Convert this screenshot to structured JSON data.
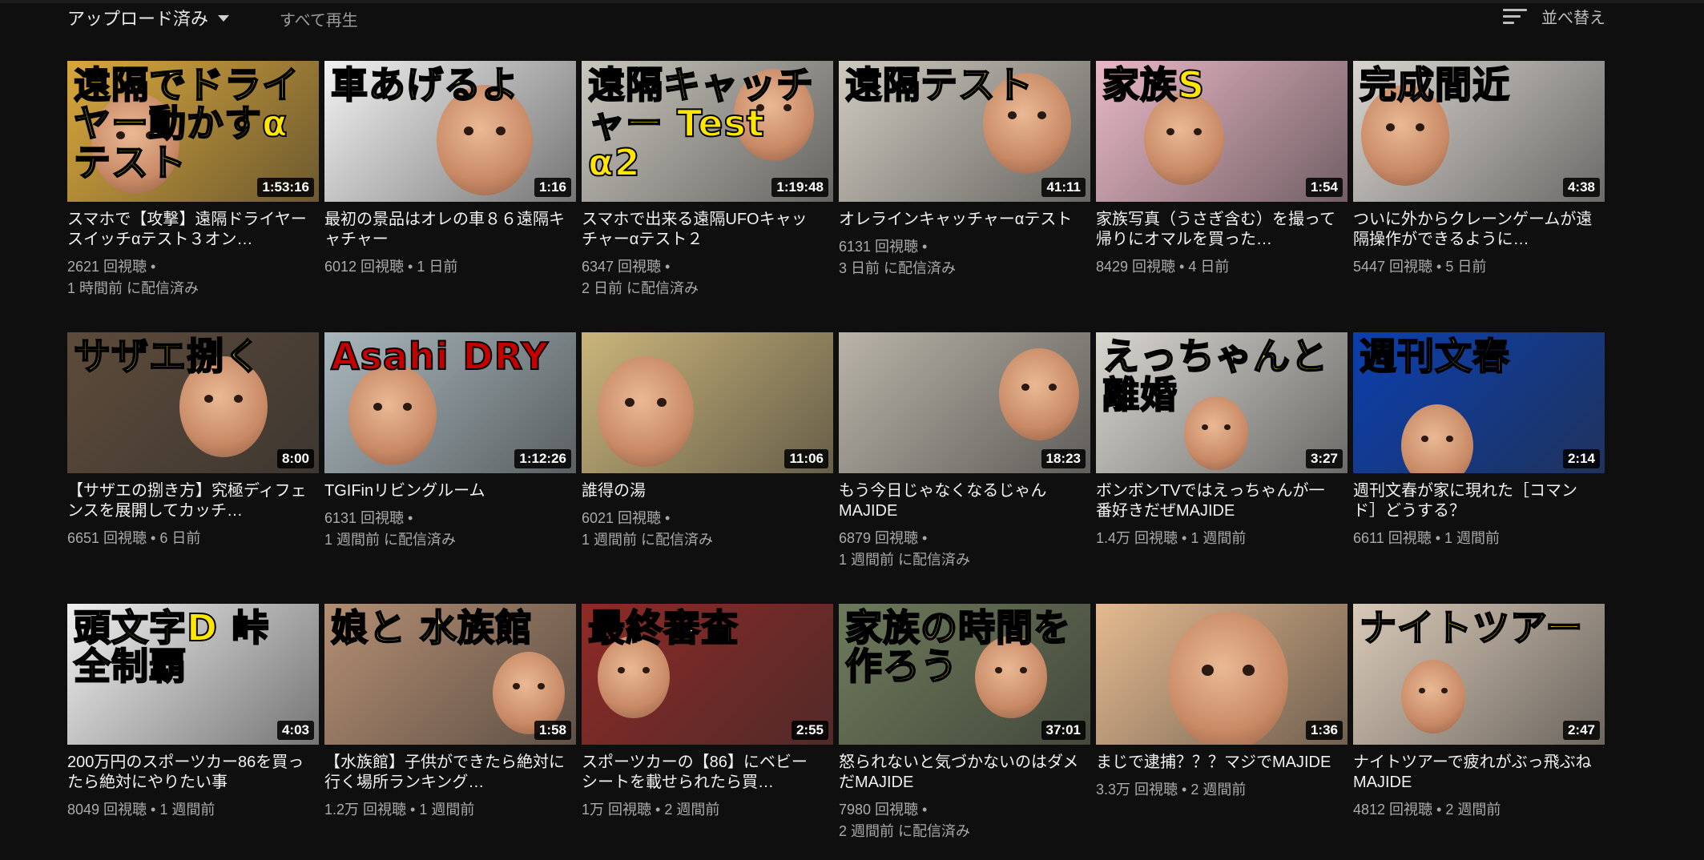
{
  "toolbar": {
    "filter_label": "アップロード済み",
    "play_all_label": "すべて再生",
    "sort_label": "並べ替え"
  },
  "videos": [
    {
      "thumb_text": "遠隔でドライヤー動かすαテスト",
      "duration": "1:53:16",
      "title": "スマホで【攻撃】遠隔ドライヤースイッチαテスト３オン…",
      "views": "2621 回視聴 •",
      "age": "1 時間前 に配信済み",
      "colors": {
        "bg": "#d9a73a",
        "text": "#ffe600"
      }
    },
    {
      "thumb_text": "車あげるよ",
      "duration": "1:16",
      "title": "最初の景品はオレの車８６遠隔キャチャー",
      "views": "6012 回視聴 • 1 日前",
      "age": "",
      "colors": {
        "bg": "#f2f2f2",
        "text": "#ffe600"
      }
    },
    {
      "thumb_text": "遠隔キャッチャー Test α2",
      "duration": "1:19:48",
      "title": "スマホで出来る遠隔UFOキャッチャーαテスト２",
      "views": "6347 回視聴 •",
      "age": "2 日前 に配信済み",
      "colors": {
        "bg": "#c9c6bd",
        "text": "#ffe600"
      }
    },
    {
      "thumb_text": "遠隔テスト",
      "duration": "41:11",
      "title": "オレラインキャッチャーαテスト",
      "views": "6131 回視聴 •",
      "age": "3 日前 に配信済み",
      "colors": {
        "bg": "#cfcac0",
        "text": "#ffe600"
      }
    },
    {
      "thumb_text": "家族S",
      "duration": "1:54",
      "title": "家族写真（うさぎ含む）を撮って帰りにオマルを買った…",
      "views": "8429 回視聴 • 4 日前",
      "age": "",
      "colors": {
        "bg": "#e8b7c6",
        "text": "#ffe600"
      }
    },
    {
      "thumb_text": "完成間近",
      "duration": "4:38",
      "title": "ついに外からクレーンゲームが遠隔操作ができるように…",
      "views": "5447 回視聴 • 5 日前",
      "age": "",
      "colors": {
        "bg": "#d8d4cf",
        "text": "#ffffff"
      }
    },
    {
      "thumb_text": "サザエ捌く",
      "duration": "8:00",
      "title": "【サザエの捌き方】究極ディフェンスを展開してカッチ…",
      "views": "6651 回視聴 • 6 日前",
      "age": "",
      "colors": {
        "bg": "#5d4b3a",
        "text": "#ffe600"
      }
    },
    {
      "thumb_text": "Asahi DRY",
      "duration": "1:12:26",
      "title": "TGIFinリビングルーム",
      "views": "6131 回視聴 •",
      "age": "1 週間前 に配信済み",
      "colors": {
        "bg": "#a9b7bd",
        "text": "#c40000"
      }
    },
    {
      "thumb_text": "",
      "duration": "11:06",
      "title": "誰得の湯",
      "views": "6021 回視聴 •",
      "age": "1 週間前 に配信済み",
      "colors": {
        "bg": "#c9b47a",
        "text": "#ffe600"
      }
    },
    {
      "thumb_text": "",
      "duration": "18:23",
      "title": "もう今日じゃなくなるじゃんMAJIDE",
      "views": "6879 回視聴 •",
      "age": "1 週間前 に配信済み",
      "colors": {
        "bg": "#b9b3a8",
        "text": "#ffe600"
      }
    },
    {
      "thumb_text": "えっちゃんと離婚",
      "duration": "3:27",
      "title": "ボンボンTVではえっちゃんが一番好きだぜMAJIDE",
      "views": "1.4万 回視聴 • 1 週間前",
      "age": "",
      "colors": {
        "bg": "#d9d6d0",
        "text": "#ffe600"
      }
    },
    {
      "thumb_text": "週刊文春",
      "duration": "2:14",
      "title": "週刊文春が家に現れた［コマンド］どうする？",
      "views": "6611 回視聴 • 1 週間前",
      "age": "",
      "colors": {
        "bg": "#0b3fae",
        "text": "#ffffff"
      }
    },
    {
      "thumb_text": "頭文字D 峠 全制覇",
      "duration": "4:03",
      "title": "200万円のスポーツカー86を買ったら絶対にやりたい事",
      "views": "8049 回視聴 • 1 週間前",
      "age": "",
      "colors": {
        "bg": "#f0f0f0",
        "text": "#ffe600"
      }
    },
    {
      "thumb_text": "娘と 水族館",
      "duration": "1:58",
      "title": "【水族館】子供ができたら絶対に行く場所ランキング…",
      "views": "1.2万 回視聴 • 1 週間前",
      "age": "",
      "colors": {
        "bg": "#b48e72",
        "text": "#ffe600"
      }
    },
    {
      "thumb_text": "最終審査",
      "duration": "2:55",
      "title": "スポーツカーの【86】にベビーシートを載せられたら買…",
      "views": "1万 回視聴 • 2 週間前",
      "age": "",
      "colors": {
        "bg": "#8f2a26",
        "text": "#ffe600"
      }
    },
    {
      "thumb_text": "家族の時間を作ろう",
      "duration": "37:01",
      "title": "怒られないと気づかないのはダメだMAJIDE",
      "views": "7980 回視聴 •",
      "age": "2 週間前 に配信済み",
      "colors": {
        "bg": "#6d7a5a",
        "text": "#ffe600"
      }
    },
    {
      "thumb_text": "",
      "duration": "1:36",
      "title": "まじで逮捕？？？マジでMAJIDE",
      "views": "3.3万 回視聴 • 2 週間前",
      "age": "",
      "colors": {
        "bg": "#e4b98f",
        "text": "#ffe600"
      }
    },
    {
      "thumb_text": "ナイトツアー",
      "duration": "2:47",
      "title": "ナイトツアーで疲れがぶっ飛ぶねMAJIDE",
      "views": "4812 回視聴 • 2 週間前",
      "age": "",
      "colors": {
        "bg": "#d9c9b7",
        "text": "#ffe600"
      }
    }
  ]
}
